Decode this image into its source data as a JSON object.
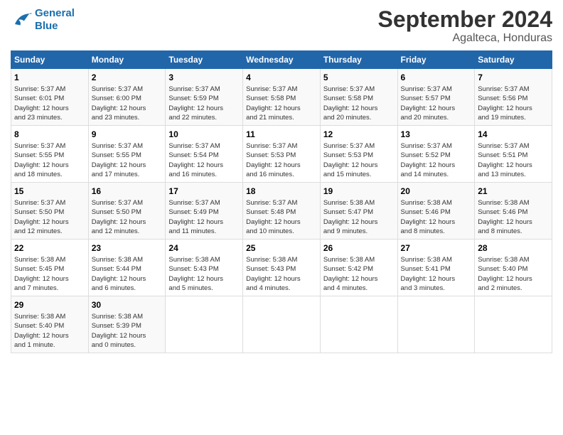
{
  "logo": {
    "line1": "General",
    "line2": "Blue"
  },
  "header": {
    "month": "September 2024",
    "location": "Agalteca, Honduras"
  },
  "days_of_week": [
    "Sunday",
    "Monday",
    "Tuesday",
    "Wednesday",
    "Thursday",
    "Friday",
    "Saturday"
  ],
  "weeks": [
    [
      {
        "day": "1",
        "info": "Sunrise: 5:37 AM\nSunset: 6:01 PM\nDaylight: 12 hours\nand 23 minutes."
      },
      {
        "day": "2",
        "info": "Sunrise: 5:37 AM\nSunset: 6:00 PM\nDaylight: 12 hours\nand 23 minutes."
      },
      {
        "day": "3",
        "info": "Sunrise: 5:37 AM\nSunset: 5:59 PM\nDaylight: 12 hours\nand 22 minutes."
      },
      {
        "day": "4",
        "info": "Sunrise: 5:37 AM\nSunset: 5:58 PM\nDaylight: 12 hours\nand 21 minutes."
      },
      {
        "day": "5",
        "info": "Sunrise: 5:37 AM\nSunset: 5:58 PM\nDaylight: 12 hours\nand 20 minutes."
      },
      {
        "day": "6",
        "info": "Sunrise: 5:37 AM\nSunset: 5:57 PM\nDaylight: 12 hours\nand 20 minutes."
      },
      {
        "day": "7",
        "info": "Sunrise: 5:37 AM\nSunset: 5:56 PM\nDaylight: 12 hours\nand 19 minutes."
      }
    ],
    [
      {
        "day": "8",
        "info": "Sunrise: 5:37 AM\nSunset: 5:55 PM\nDaylight: 12 hours\nand 18 minutes."
      },
      {
        "day": "9",
        "info": "Sunrise: 5:37 AM\nSunset: 5:55 PM\nDaylight: 12 hours\nand 17 minutes."
      },
      {
        "day": "10",
        "info": "Sunrise: 5:37 AM\nSunset: 5:54 PM\nDaylight: 12 hours\nand 16 minutes."
      },
      {
        "day": "11",
        "info": "Sunrise: 5:37 AM\nSunset: 5:53 PM\nDaylight: 12 hours\nand 16 minutes."
      },
      {
        "day": "12",
        "info": "Sunrise: 5:37 AM\nSunset: 5:53 PM\nDaylight: 12 hours\nand 15 minutes."
      },
      {
        "day": "13",
        "info": "Sunrise: 5:37 AM\nSunset: 5:52 PM\nDaylight: 12 hours\nand 14 minutes."
      },
      {
        "day": "14",
        "info": "Sunrise: 5:37 AM\nSunset: 5:51 PM\nDaylight: 12 hours\nand 13 minutes."
      }
    ],
    [
      {
        "day": "15",
        "info": "Sunrise: 5:37 AM\nSunset: 5:50 PM\nDaylight: 12 hours\nand 12 minutes."
      },
      {
        "day": "16",
        "info": "Sunrise: 5:37 AM\nSunset: 5:50 PM\nDaylight: 12 hours\nand 12 minutes."
      },
      {
        "day": "17",
        "info": "Sunrise: 5:37 AM\nSunset: 5:49 PM\nDaylight: 12 hours\nand 11 minutes."
      },
      {
        "day": "18",
        "info": "Sunrise: 5:37 AM\nSunset: 5:48 PM\nDaylight: 12 hours\nand 10 minutes."
      },
      {
        "day": "19",
        "info": "Sunrise: 5:38 AM\nSunset: 5:47 PM\nDaylight: 12 hours\nand 9 minutes."
      },
      {
        "day": "20",
        "info": "Sunrise: 5:38 AM\nSunset: 5:46 PM\nDaylight: 12 hours\nand 8 minutes."
      },
      {
        "day": "21",
        "info": "Sunrise: 5:38 AM\nSunset: 5:46 PM\nDaylight: 12 hours\nand 8 minutes."
      }
    ],
    [
      {
        "day": "22",
        "info": "Sunrise: 5:38 AM\nSunset: 5:45 PM\nDaylight: 12 hours\nand 7 minutes."
      },
      {
        "day": "23",
        "info": "Sunrise: 5:38 AM\nSunset: 5:44 PM\nDaylight: 12 hours\nand 6 minutes."
      },
      {
        "day": "24",
        "info": "Sunrise: 5:38 AM\nSunset: 5:43 PM\nDaylight: 12 hours\nand 5 minutes."
      },
      {
        "day": "25",
        "info": "Sunrise: 5:38 AM\nSunset: 5:43 PM\nDaylight: 12 hours\nand 4 minutes."
      },
      {
        "day": "26",
        "info": "Sunrise: 5:38 AM\nSunset: 5:42 PM\nDaylight: 12 hours\nand 4 minutes."
      },
      {
        "day": "27",
        "info": "Sunrise: 5:38 AM\nSunset: 5:41 PM\nDaylight: 12 hours\nand 3 minutes."
      },
      {
        "day": "28",
        "info": "Sunrise: 5:38 AM\nSunset: 5:40 PM\nDaylight: 12 hours\nand 2 minutes."
      }
    ],
    [
      {
        "day": "29",
        "info": "Sunrise: 5:38 AM\nSunset: 5:40 PM\nDaylight: 12 hours\nand 1 minute."
      },
      {
        "day": "30",
        "info": "Sunrise: 5:38 AM\nSunset: 5:39 PM\nDaylight: 12 hours\nand 0 minutes."
      },
      {
        "day": "",
        "info": ""
      },
      {
        "day": "",
        "info": ""
      },
      {
        "day": "",
        "info": ""
      },
      {
        "day": "",
        "info": ""
      },
      {
        "day": "",
        "info": ""
      }
    ]
  ]
}
